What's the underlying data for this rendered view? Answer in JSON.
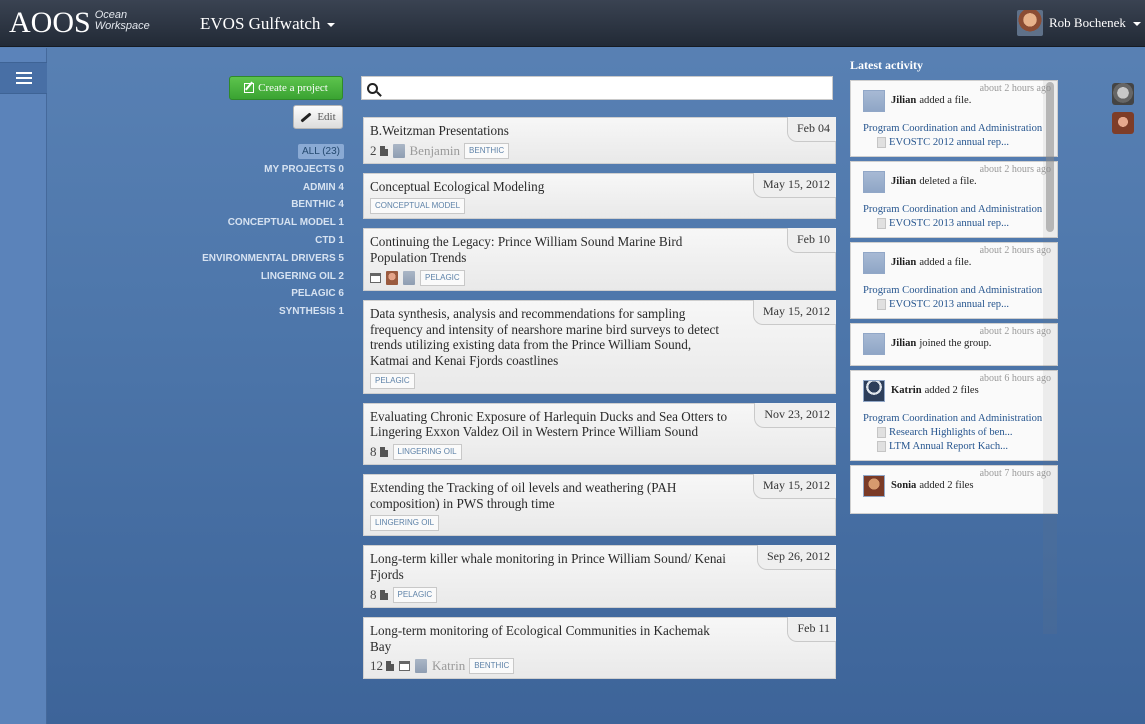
{
  "app": {
    "logo_main": "AOOS",
    "logo_sub_1": "Ocean",
    "logo_sub_2": "Workspace",
    "workspace": "EVOS Gulfwatch",
    "user": "Rob Bochenek"
  },
  "toolbar": {
    "create_label": "Create a project",
    "edit_label": "Edit",
    "search_placeholder": ""
  },
  "filters": [
    {
      "label": "ALL (23)",
      "active": true
    },
    {
      "label": "MY PROJECTS 0"
    },
    {
      "label": "ADMIN 4"
    },
    {
      "label": "BENTHIC 4"
    },
    {
      "label": "CONCEPTUAL MODEL 1"
    },
    {
      "label": "CTD 1"
    },
    {
      "label": "ENVIRONMENTAL DRIVERS 5"
    },
    {
      "label": "LINGERING OIL 2"
    },
    {
      "label": "PELAGIC 6"
    },
    {
      "label": "SYNTHESIS 1"
    }
  ],
  "projects": [
    {
      "title": "B.Weitzman Presentations",
      "date": "Feb 04",
      "count": "2",
      "person": "Benjamin",
      "tags": [
        "BENTHIC"
      ]
    },
    {
      "title": "Conceptual Ecological Modeling",
      "date": "May 15, 2012",
      "tags": [
        "CONCEPTUAL MODEL"
      ]
    },
    {
      "title": "Continuing the Legacy: Prince William Sound Marine Bird Population Trends",
      "date": "Feb 10",
      "tags": [
        "PELAGIC"
      ]
    },
    {
      "title": "Data synthesis, analysis and recommendations for sampling frequency and intensity of nearshore marine bird surveys to detect trends utilizing existing data from the Prince William Sound, Katmai and Kenai Fjords coastlines",
      "date": "May 15, 2012",
      "tags": [
        "PELAGIC"
      ]
    },
    {
      "title": "Evaluating Chronic Exposure of Harlequin Ducks and Sea Otters to Lingering Exxon Valdez Oil in Western Prince William Sound",
      "date": "Nov 23, 2012",
      "count": "8",
      "tags": [
        "LINGERING OIL"
      ]
    },
    {
      "title": "Extending the Tracking of oil levels and weathering (PAH composition) in PWS through time",
      "date": "May 15, 2012",
      "tags": [
        "LINGERING OIL"
      ]
    },
    {
      "title": "Long-term killer whale monitoring in Prince William Sound/ Kenai Fjords",
      "date": "Sep 26, 2012",
      "count": "8",
      "tags": [
        "PELAGIC"
      ]
    },
    {
      "title": "Long-term monitoring of Ecological Communities in Kachemak Bay",
      "date": "Feb 11",
      "count": "12",
      "person": "Katrin",
      "tags": [
        "BENTHIC"
      ]
    }
  ],
  "activity": {
    "title": "Latest activity",
    "items": [
      {
        "time": "about 2 hours ago",
        "name": "Jilian",
        "action": "added a file.",
        "project": "Program Coordination and Administration",
        "files": [
          "EVOSTC 2012 annual rep..."
        ]
      },
      {
        "time": "about 2 hours ago",
        "name": "Jilian",
        "action": "deleted a file.",
        "project": "Program Coordination and Administration",
        "files": [
          "EVOSTC 2013 annual rep..."
        ]
      },
      {
        "time": "about 2 hours ago",
        "name": "Jilian",
        "action": "added a file.",
        "project": "Program Coordination and Administration",
        "files": [
          "EVOSTC 2013 annual rep..."
        ]
      },
      {
        "time": "about 2 hours ago",
        "name": "Jilian",
        "action": "joined the group."
      },
      {
        "time": "about 6 hours ago",
        "name": "Katrin",
        "action": "added 2 files",
        "project": "Program Coordination and Administration",
        "files": [
          "Research Highlights of ben...",
          "LTM Annual Report Kach..."
        ]
      },
      {
        "time": "about 7 hours ago",
        "name": "Sonia",
        "action": "added 2 files"
      }
    ]
  }
}
